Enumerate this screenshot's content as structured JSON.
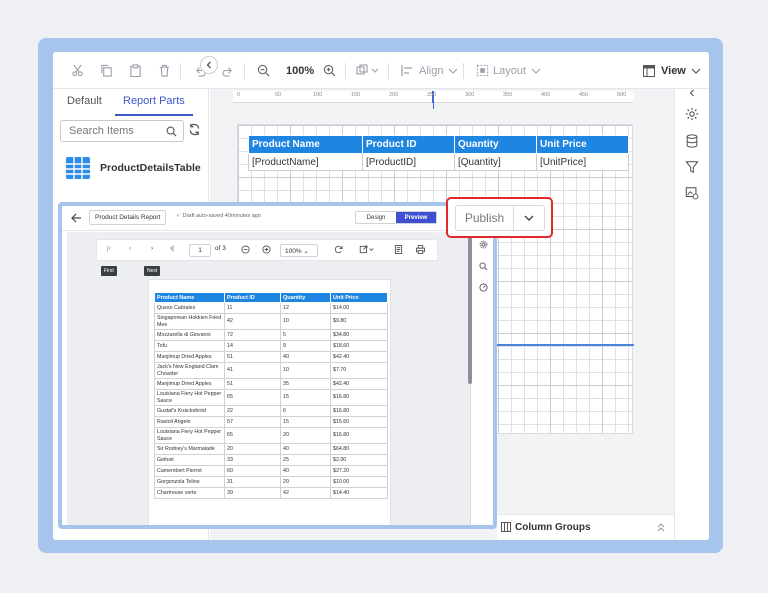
{
  "toolbar": {
    "zoom": "100%",
    "align_label": "Align",
    "layout_label": "Layout",
    "view_label": "View"
  },
  "left_panel": {
    "tabs": [
      "Default",
      "Report Parts"
    ],
    "active_tab": "Report Parts",
    "search_placeholder": "Search Items",
    "parts": [
      {
        "label": "ProductDetailsTable",
        "icon": "table-icon"
      }
    ]
  },
  "ruler": {
    "ticks": [
      "0",
      "50",
      "100",
      "150",
      "200",
      "250",
      "300",
      "350",
      "400",
      "450",
      "500"
    ]
  },
  "designer_table": {
    "headers": [
      "Product Name",
      "Product ID",
      "Quantity",
      "Unit Price"
    ],
    "row": [
      "[ProductName]",
      "[ProductID]",
      "[Quantity]",
      "[UnitPrice]"
    ]
  },
  "publish": {
    "label": "Publish"
  },
  "column_groups": {
    "label": "Column Groups"
  },
  "preview": {
    "report_title": "Product Details Report",
    "status": "Draft auto-saved 40minutes ago",
    "mode_design": "Design",
    "mode_preview": "Preview",
    "page_current": "1",
    "page_total": "of 3",
    "zoom": "100%",
    "tooltip_first": "First",
    "tooltip_next": "Next",
    "table_headers": [
      "Product Name",
      "Product ID",
      "Quantity",
      "Unit Price"
    ],
    "rows": [
      [
        "Queso Cabrales",
        "11",
        "12",
        "$14.00"
      ],
      [
        "Singaporean Hokkien Fried Mee",
        "42",
        "10",
        "$9.80"
      ],
      [
        "Mozzarella di Giovanni",
        "72",
        "5",
        "$34.80"
      ],
      [
        "Tofu",
        "14",
        "9",
        "$18.60"
      ],
      [
        "Manjimup Dried Apples",
        "51",
        "40",
        "$42.40"
      ],
      [
        "Jack's New England Clam Chowder",
        "41",
        "10",
        "$7.70"
      ],
      [
        "Manjimup Dried Apples",
        "51",
        "35",
        "$42.40"
      ],
      [
        "Louisiana Fiery Hot Pepper Sauce",
        "65",
        "15",
        "$16.80"
      ],
      [
        "Gustaf's Knäckebröd",
        "22",
        "6",
        "$16.80"
      ],
      [
        "Ravioli Angelo",
        "57",
        "15",
        "$15.60"
      ],
      [
        "Louisiana Fiery Hot Pepper Sauce",
        "65",
        "20",
        "$16.80"
      ],
      [
        "Sir Rodney's Marmalade",
        "20",
        "40",
        "$64.80"
      ],
      [
        "Geitost",
        "33",
        "25",
        "$2.00"
      ],
      [
        "Camembert Pierrot",
        "60",
        "40",
        "$27.20"
      ],
      [
        "Gorgonzola Telino",
        "31",
        "20",
        "$10.00"
      ],
      [
        "Chartreuse verte",
        "39",
        "42",
        "$14.40"
      ]
    ]
  },
  "colors": {
    "accent": "#3e57c9",
    "table_header": "#1e86e0",
    "highlight": "#e02a2a",
    "frame": "#a6c4ec"
  }
}
